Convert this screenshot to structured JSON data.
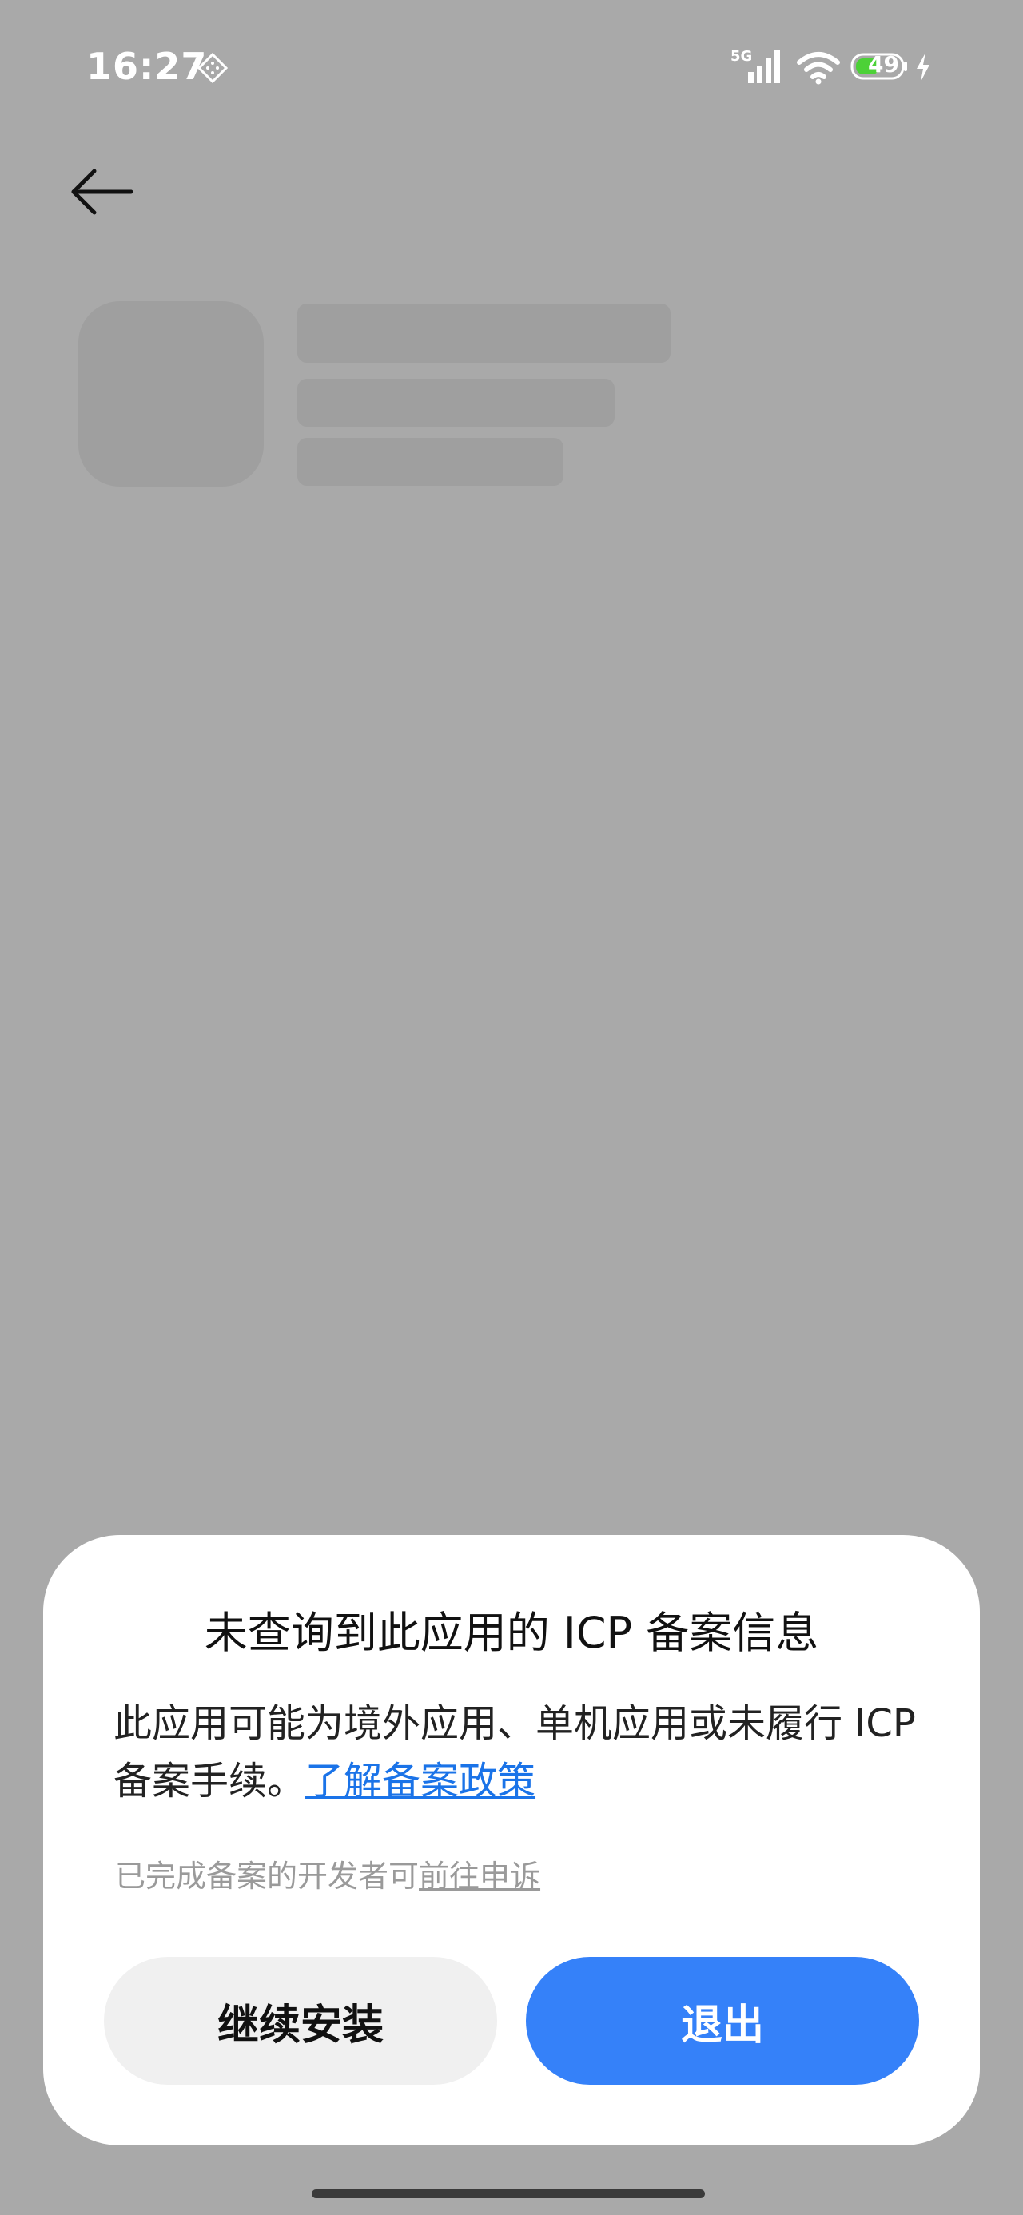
{
  "status_bar": {
    "time": "16:27",
    "network": "5G",
    "battery_level": "49",
    "icons": [
      "diamond-icon",
      "signal-icon",
      "wifi-icon",
      "battery-icon",
      "bolt-icon"
    ],
    "battery_fill_color": "#4cd137"
  },
  "header": {
    "back_icon": "arrow-left-icon"
  },
  "dialog": {
    "title": "未查询到此应用的 ICP 备案信息",
    "body_text": "此应用可能为境外应用、单机应用或未履行 ICP 备案手续。",
    "policy_link": "了解备案政策",
    "appeal_prefix": "已完成备案的开发者可",
    "appeal_link": "前往申诉",
    "continue_label": "继续安装",
    "exit_label": "退出"
  },
  "colors": {
    "background_overlay": "#a9a9a9",
    "link": "#1a73e8",
    "primary_button": "#3581f9",
    "secondary_button": "#f0f0f0"
  }
}
